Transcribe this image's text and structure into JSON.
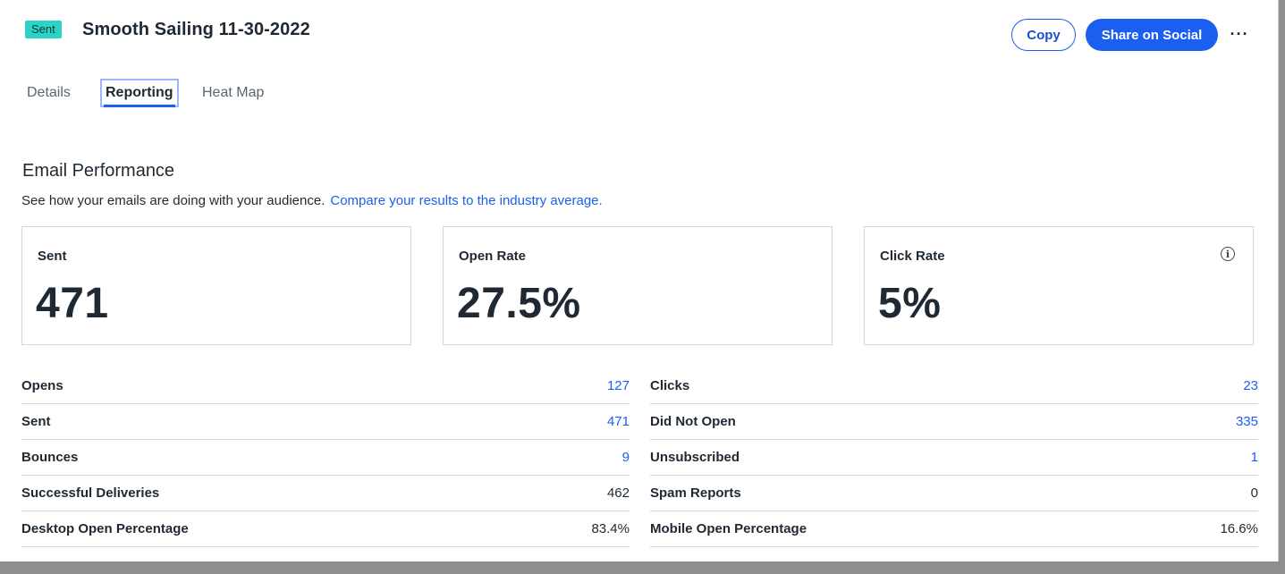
{
  "header": {
    "badge": "Sent",
    "title": "Smooth Sailing 11-30-2022",
    "copy_label": "Copy",
    "share_label": "Share on Social",
    "more_label": "···"
  },
  "tabs": [
    {
      "label": "Details",
      "active": false
    },
    {
      "label": "Reporting",
      "active": true
    },
    {
      "label": "Heat Map",
      "active": false
    }
  ],
  "section": {
    "title": "Email Performance",
    "subtitle": "See how your emails are doing with your audience.",
    "link": "Compare your results to the industry average."
  },
  "cards": [
    {
      "label": "Sent",
      "value": "471"
    },
    {
      "label": "Open Rate",
      "value": "27.5%"
    },
    {
      "label": "Click Rate",
      "value": "5%",
      "info_icon": "info-icon"
    }
  ],
  "stats_left": [
    {
      "label": "Opens",
      "value": "127",
      "link": true
    },
    {
      "label": "Sent",
      "value": "471",
      "link": true
    },
    {
      "label": "Bounces",
      "value": "9",
      "link": true
    },
    {
      "label": "Successful Deliveries",
      "value": "462",
      "link": false
    },
    {
      "label": "Desktop Open Percentage",
      "value": "83.4%",
      "link": false
    }
  ],
  "stats_right": [
    {
      "label": "Clicks",
      "value": "23",
      "link": true
    },
    {
      "label": "Did Not Open",
      "value": "335",
      "link": true
    },
    {
      "label": "Unsubscribed",
      "value": "1",
      "link": true
    },
    {
      "label": "Spam Reports",
      "value": "0",
      "link": false
    },
    {
      "label": "Mobile Open Percentage",
      "value": "16.6%",
      "link": false
    }
  ],
  "colors": {
    "accent": "#1b5ff0",
    "badge": "#2ad3c5",
    "text": "#1f2933",
    "border": "#d5d9de"
  }
}
